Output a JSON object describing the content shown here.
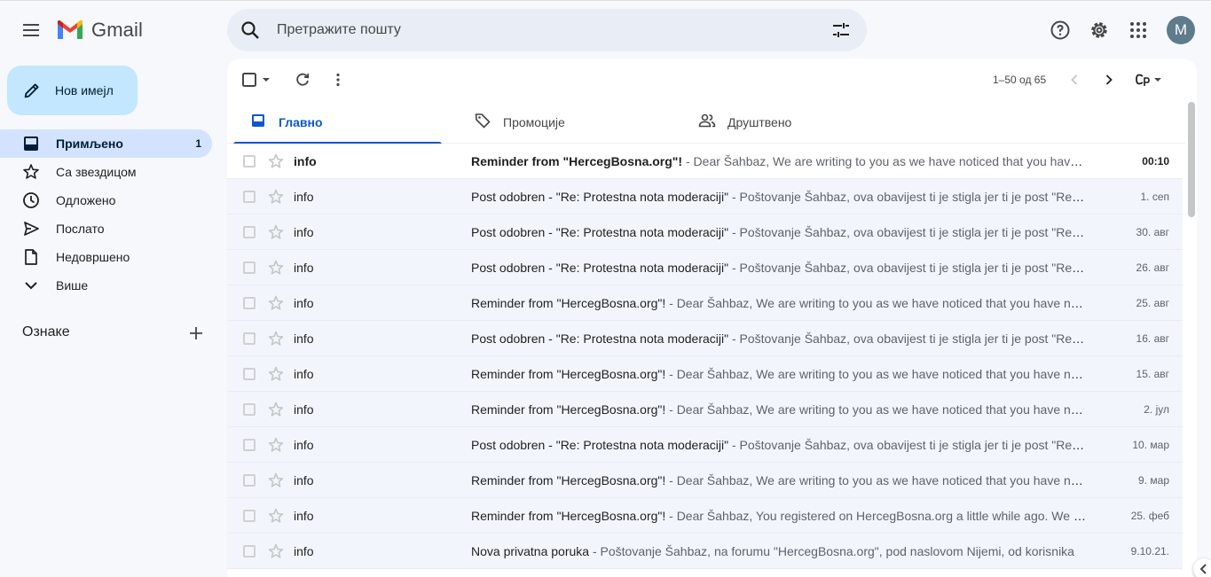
{
  "header": {
    "app_name": "Gmail",
    "search_placeholder": "Претражите пошту",
    "avatar_letter": "M"
  },
  "compose_label": "Нов имејл",
  "sidebar": {
    "items": [
      {
        "label": "Примљено",
        "count": "1",
        "icon": "inbox-icon"
      },
      {
        "label": "Са звездицом",
        "count": "",
        "icon": "star-icon"
      },
      {
        "label": "Одложено",
        "count": "",
        "icon": "clock-icon"
      },
      {
        "label": "Послато",
        "count": "",
        "icon": "send-icon"
      },
      {
        "label": "Недовршено",
        "count": "",
        "icon": "draft-icon"
      },
      {
        "label": "Више",
        "count": "",
        "icon": "chevron-down-icon"
      }
    ],
    "labels_title": "Ознаке"
  },
  "toolbar": {
    "pager": "1–50 од 65"
  },
  "tabs": [
    {
      "label": "Главно",
      "active": true
    },
    {
      "label": "Промоције",
      "active": false
    },
    {
      "label": "Друштвено",
      "active": false
    }
  ],
  "emails": [
    {
      "sender": "info",
      "subject": "Reminder from \"HercegBosna.org\"!",
      "snippet": " - Dear Šahbaz, We are writing to you as we have noticed that you have not visited HercegBosna.org",
      "date": "00:10",
      "unread": true
    },
    {
      "sender": "info",
      "subject": "Post odobren - \"Re: Protestna nota moderaciji\"",
      "snippet": " - Poštovanje Šahbaz, ova obavijest ti je stigla jer ti je post \"Re: Protestna nota\"",
      "date": "1. сеп",
      "unread": false
    },
    {
      "sender": "info",
      "subject": "Post odobren - \"Re: Protestna nota moderaciji\"",
      "snippet": " - Poštovanje Šahbaz, ova obavijest ti je stigla jer ti je post \"Re: Protestna nota\"",
      "date": "30. авг",
      "unread": false
    },
    {
      "sender": "info",
      "subject": "Post odobren - \"Re: Protestna nota moderaciji\"",
      "snippet": " - Poštovanje Šahbaz, ova obavijest ti je stigla jer ti je post \"Re: Protestna nota\"",
      "date": "26. авг",
      "unread": false
    },
    {
      "sender": "info",
      "subject": "Reminder from \"HercegBosna.org\"!",
      "snippet": " - Dear Šahbaz, We are writing to you as we have noticed that you have not visited",
      "date": "25. авг",
      "unread": false
    },
    {
      "sender": "info",
      "subject": "Post odobren - \"Re: Protestna nota moderaciji\"",
      "snippet": " - Poštovanje Šahbaz, ova obavijest ti je stigla jer ti je post \"Re: Protestna nota\"",
      "date": "16. авг",
      "unread": false
    },
    {
      "sender": "info",
      "subject": "Reminder from \"HercegBosna.org\"!",
      "snippet": " - Dear Šahbaz, We are writing to you as we have noticed that you have not visited",
      "date": "15. авг",
      "unread": false
    },
    {
      "sender": "info",
      "subject": "Reminder from \"HercegBosna.org\"!",
      "snippet": " - Dear Šahbaz, We are writing to you as we have noticed that you have not visited",
      "date": "2. јул",
      "unread": false
    },
    {
      "sender": "info",
      "subject": "Post odobren - \"Re: Protestna nota moderaciji\"",
      "snippet": " - Poštovanje Šahbaz, ova obavijest ti je stigla jer ti je post \"Re: Protestna nota\"",
      "date": "10. мар",
      "unread": false
    },
    {
      "sender": "info",
      "subject": "Reminder from \"HercegBosna.org\"!",
      "snippet": " - Dear Šahbaz, We are writing to you as we have noticed that you have not visited",
      "date": "9. мар",
      "unread": false
    },
    {
      "sender": "info",
      "subject": "Reminder from \"HercegBosna.org\"!",
      "snippet": " - Dear Šahbaz, You registered on HercegBosna.org a little while ago. We hope",
      "date": "25. феб",
      "unread": false
    },
    {
      "sender": "info",
      "subject": "Nova privatna poruka",
      "snippet": " - Poštovanje Šahbaz, na forumu \"HercegBosna.org\", pod naslovom Nijemi, od korisnika",
      "date": "9.10.21.",
      "unread": false
    }
  ],
  "colors": {
    "accent": "#0b57d0",
    "compose_bg": "#c2e7ff",
    "active_nav_bg": "#d3e3fd",
    "app_bg": "#f6f8fc"
  }
}
